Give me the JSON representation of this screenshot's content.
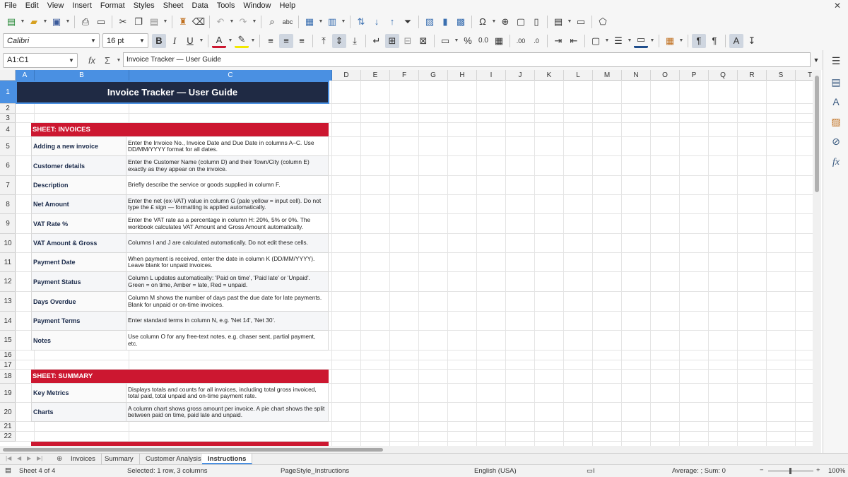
{
  "menu": [
    "File",
    "Edit",
    "View",
    "Insert",
    "Format",
    "Styles",
    "Sheet",
    "Data",
    "Tools",
    "Window",
    "Help"
  ],
  "font": {
    "name": "Calibri",
    "size": "16 pt"
  },
  "name_box": "A1:C1",
  "formula": "Invoice Tracker — User Guide",
  "columns": [
    "A",
    "B",
    "C",
    "D",
    "E",
    "F",
    "G",
    "H",
    "I",
    "J",
    "K",
    "L",
    "M",
    "N",
    "O",
    "P",
    "Q",
    "R",
    "S",
    "T"
  ],
  "rows": [
    "1",
    "2",
    "3",
    "4",
    "5",
    "6",
    "7",
    "8",
    "9",
    "10",
    "11",
    "12",
    "13",
    "14",
    "15",
    "16",
    "17",
    "18",
    "19",
    "20",
    "21",
    "22"
  ],
  "sheet": {
    "title": "Invoice Tracker — User Guide",
    "sections": [
      {
        "header": "SHEET: INVOICES",
        "items": [
          {
            "label": "Adding a new invoice",
            "desc": "Enter the Invoice No., Invoice Date and Due Date in columns A–C. Use DD/MM/YYYY format for all dates."
          },
          {
            "label": "Customer details",
            "desc": "Enter the Customer Name (column D) and their Town/City (column E) exactly as they appear on the invoice."
          },
          {
            "label": "Description",
            "desc": "Briefly describe the service or goods supplied in column F."
          },
          {
            "label": "Net Amount",
            "desc": "Enter the net (ex-VAT) value in column G (pale yellow = input cell). Do not type the £ sign — formatting is applied automatically."
          },
          {
            "label": "VAT Rate %",
            "desc": "Enter the VAT rate as a percentage in column H: 20%, 5% or 0%. The workbook calculates VAT Amount and Gross Amount automatically."
          },
          {
            "label": "VAT Amount & Gross",
            "desc": "Columns I and J are calculated automatically. Do not edit these cells."
          },
          {
            "label": "Payment Date",
            "desc": "When payment is received, enter the date in column K (DD/MM/YYYY). Leave blank for unpaid invoices."
          },
          {
            "label": "Payment Status",
            "desc": "Column L updates automatically: 'Paid on time', 'Paid late' or 'Unpaid'. Green = on time, Amber = late, Red = unpaid."
          },
          {
            "label": "Days Overdue",
            "desc": "Column M shows the number of days past the due date for late payments. Blank for unpaid or on-time invoices."
          },
          {
            "label": "Payment Terms",
            "desc": "Enter standard terms in column N, e.g. 'Net 14', 'Net 30'."
          },
          {
            "label": "Notes",
            "desc": "Use column O for any free-text notes, e.g. chaser sent, partial payment, etc."
          }
        ]
      },
      {
        "header": "SHEET: SUMMARY",
        "items": [
          {
            "label": "Key Metrics",
            "desc": "Displays totals and counts for all invoices, including total gross invoiced, total paid, total unpaid and on-time payment rate."
          },
          {
            "label": "Charts",
            "desc": "A column chart shows gross amount per invoice. A pie chart shows the split between paid on time, paid late and unpaid."
          }
        ]
      }
    ]
  },
  "tabs": [
    "Invoices",
    "Summary",
    "Customer Analysis",
    "Instructions"
  ],
  "active_tab": "Instructions",
  "status": {
    "sheet": "Sheet 4 of 4",
    "selection": "Selected: 1 row, 3 columns",
    "page_style": "PageStyle_Instructions",
    "language": "English (USA)",
    "aggregate": "Average: ; Sum: 0",
    "zoom": "100%"
  }
}
